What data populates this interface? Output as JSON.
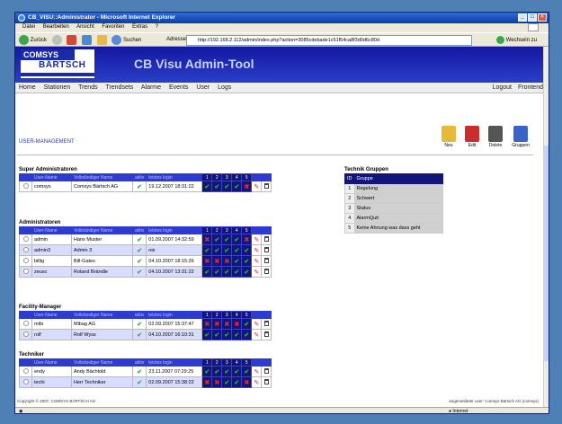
{
  "window": {
    "title": "CB_VISU::Administrator - Microsoft Internet Explorer"
  },
  "menu": [
    "Datei",
    "Bearbeiten",
    "Ansicht",
    "Favoriten",
    "Extras",
    "?"
  ],
  "toolbar": {
    "back": "Zurück",
    "search": "Suchen",
    "address_label": "Adresse",
    "address": "http://192.168.2.112/admin/index.php?action=3085cdebade1c51f54ca8f3d0d6c80d",
    "go": "Wechseln zu"
  },
  "brand": {
    "company": "COMSYS",
    "company2": "BÄRTSCH",
    "app_title": "CB Visu Admin-Tool"
  },
  "nav": {
    "items": [
      "Home",
      "Stationen",
      "Trends",
      "Trendsets",
      "Alarme",
      "Events",
      "User",
      "Logs"
    ],
    "logout": "Logout",
    "frontend": "Frontend"
  },
  "breadcrumb": "USER-MANAGEMENT",
  "tools": [
    {
      "label": "Neu",
      "icon": "new-icon",
      "color": "#e7b93a"
    },
    {
      "label": "Edit",
      "icon": "edit-icon",
      "color": "#c92d2d"
    },
    {
      "label": "Delete",
      "icon": "delete-icon",
      "color": "#555555"
    },
    {
      "label": "Gruppen",
      "icon": "groups-icon",
      "color": "#3a63c8"
    }
  ],
  "columns": {
    "user": "User-Name",
    "full": "Vollständiger Name",
    "active": "aktiv",
    "login": "letztes login",
    "groups": [
      "1",
      "2",
      "3",
      "4",
      "5"
    ]
  },
  "groups": [
    {
      "title": "Super Administratoren",
      "rows": [
        {
          "user": "comsys",
          "full": "Comsys Bärtsch AG",
          "login": "19.12.2007 18:31:22",
          "perm": [
            "c",
            "c",
            "c",
            "c",
            "x"
          ]
        }
      ]
    },
    {
      "title": "Administratoren",
      "rows": [
        {
          "user": "admin",
          "full": "Hans Muster",
          "login": "01.09.2007 14:32:59",
          "perm": [
            "x",
            "c",
            "c",
            "c",
            "x"
          ]
        },
        {
          "user": "admin3",
          "full": "Admin 3",
          "login": "nie",
          "perm": [
            "c",
            "c",
            "c",
            "c",
            "c"
          ]
        },
        {
          "user": "billig",
          "full": "Bill-Gates",
          "login": "04.10.2007 18:15:26",
          "perm": [
            "x",
            "x",
            "x",
            "c",
            "c"
          ]
        },
        {
          "user": "zeusc",
          "full": "Roland Brändle",
          "login": "04.10.2007 13:31:22",
          "perm": [
            "c",
            "c",
            "c",
            "c",
            "c"
          ]
        }
      ]
    },
    {
      "title": "Facility-Manager",
      "rows": [
        {
          "user": "mibi",
          "full": "Mibag AG",
          "login": "02.09.2007 15:37:47",
          "perm": [
            "x",
            "x",
            "x",
            "x",
            "c"
          ]
        },
        {
          "user": "rolf",
          "full": "Rolf Wyss",
          "login": "04.10.2007 16:10:31",
          "perm": [
            "c",
            "c",
            "c",
            "c",
            "c"
          ]
        }
      ]
    },
    {
      "title": "Techniker",
      "rows": [
        {
          "user": "endy",
          "full": "Andy Bächtold",
          "login": "23.11.2007 07:29:25",
          "perm": [
            "c",
            "c",
            "c",
            "c",
            "c"
          ]
        },
        {
          "user": "techi",
          "full": "Herr Techniker",
          "login": "02.09.2007 15:38:22",
          "perm": [
            "x",
            "x",
            "c",
            "c",
            "x"
          ]
        }
      ]
    }
  ],
  "technik": {
    "title": "Technik Gruppen",
    "header_id": "ID",
    "header_name": "Gruppe",
    "rows": [
      {
        "id": "1",
        "name": "Regelung"
      },
      {
        "id": "2",
        "name": "Schwert"
      },
      {
        "id": "3",
        "name": "Status"
      },
      {
        "id": "4",
        "name": "AlarmQuit"
      },
      {
        "id": "5",
        "name": "Keine Ahnung was dass geht"
      }
    ]
  },
  "footer": {
    "left": "Copyright © 2007, COMSYS BÄRTSCH AG",
    "right": "angemeldeter user: Comsys Bärtsch AG (comsys)"
  },
  "status": {
    "zone": "Internet"
  }
}
